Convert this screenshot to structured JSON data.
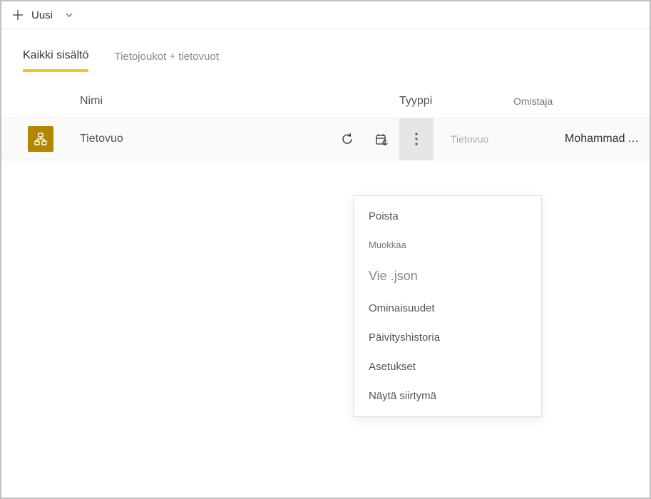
{
  "toolbar": {
    "new_label": "Uusi"
  },
  "tabs": {
    "all_content": "Kaikki sisältö",
    "datasets": "Tietojoukot +",
    "dataflows": "tietovuot"
  },
  "columns": {
    "name": "Nimi",
    "type": "Tyyppi",
    "owner": "Omistaja"
  },
  "row": {
    "name": "Tietovuo",
    "type": "Tietovuo",
    "owner": "Mohammad Ali (MO..."
  },
  "menu": {
    "delete": "Poista",
    "edit": "Muokkaa",
    "export_json": "Vie .json",
    "properties": "Ominaisuudet",
    "refresh_history": "Päivityshistoria",
    "settings": "Asetukset",
    "show_lineage": "Näytä siirtymä"
  }
}
